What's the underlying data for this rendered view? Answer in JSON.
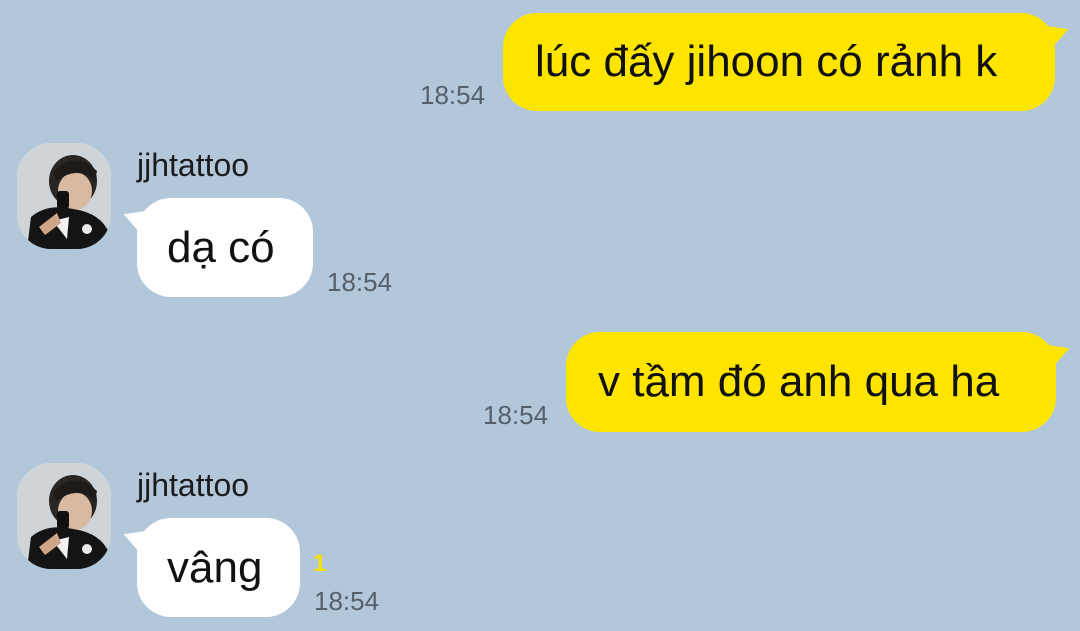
{
  "messages": [
    {
      "direction": "out",
      "text": "lúc đấy jihoon có rảnh k",
      "time": "18:54"
    },
    {
      "direction": "in",
      "sender": "jjhtattoo",
      "text": "dạ có",
      "time": "18:54",
      "avatar_icon": "profile-photo-icon"
    },
    {
      "direction": "out",
      "text": "v tầm đó anh qua ha",
      "time": "18:54"
    },
    {
      "direction": "in",
      "sender": "jjhtattoo",
      "text": "vâng",
      "time": "18:54",
      "unread": "1",
      "avatar_icon": "profile-photo-icon"
    }
  ],
  "colors": {
    "background": "#b2c7da",
    "outgoing_bubble": "#fee500",
    "incoming_bubble": "#ffffff",
    "unread_count": "#f5e000"
  }
}
